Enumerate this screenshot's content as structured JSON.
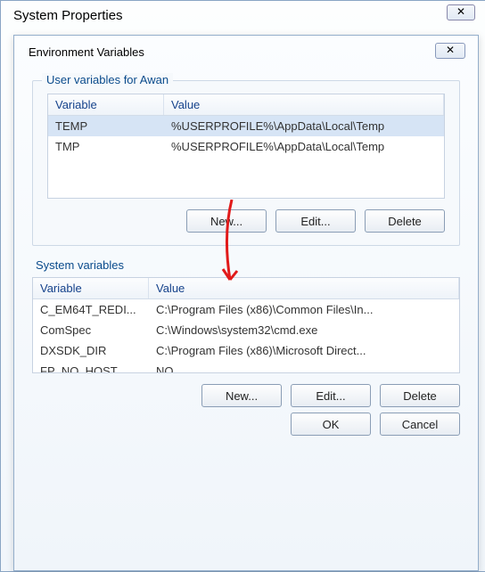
{
  "outer": {
    "title": "System Properties",
    "close_glyph": "✕"
  },
  "inner": {
    "title": "Environment Variables",
    "close_glyph": "✕"
  },
  "user_section": {
    "label": "User variables for Awan",
    "header_var": "Variable",
    "header_val": "Value",
    "rows": [
      {
        "variable": "TEMP",
        "value": "%USERPROFILE%\\AppData\\Local\\Temp"
      },
      {
        "variable": "TMP",
        "value": "%USERPROFILE%\\AppData\\Local\\Temp"
      }
    ],
    "buttons": {
      "new": "New...",
      "edit": "Edit...",
      "delete": "Delete"
    }
  },
  "system_section": {
    "label": "System variables",
    "header_var": "Variable",
    "header_val": "Value",
    "rows": [
      {
        "variable": "C_EM64T_REDI...",
        "value": "C:\\Program Files (x86)\\Common Files\\In..."
      },
      {
        "variable": "ComSpec",
        "value": "C:\\Windows\\system32\\cmd.exe"
      },
      {
        "variable": "DXSDK_DIR",
        "value": "C:\\Program Files (x86)\\Microsoft Direct..."
      },
      {
        "variable": "FP_NO_HOST_C...",
        "value": "NO"
      }
    ],
    "buttons": {
      "new": "New...",
      "edit": "Edit...",
      "delete": "Delete"
    }
  },
  "dialog_buttons": {
    "ok": "OK",
    "cancel": "Cancel"
  },
  "annotation": {
    "arrow_color": "#e11a1a"
  }
}
